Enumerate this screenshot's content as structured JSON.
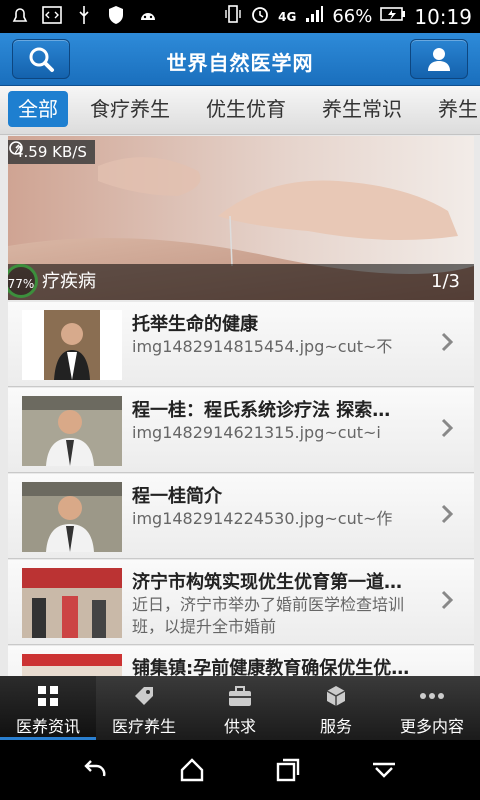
{
  "status_bar": {
    "battery": "66%",
    "time": "10:19",
    "network": "4G"
  },
  "header": {
    "title": "世界自然医学网",
    "search_icon": "search-icon",
    "user_icon": "user-icon"
  },
  "tabs": [
    "全部",
    "食疗养生",
    "优生优育",
    "养生常识",
    "养生"
  ],
  "banner": {
    "speed": "4.59 KB/S",
    "progress": "77%",
    "caption": "疗疾病",
    "pager": "1/3"
  },
  "articles": [
    {
      "title": "托举生命的健康",
      "summary": "img1482914815454.jpg~cut~不"
    },
    {
      "title": "程一桂：程氏系统诊疗法  探索…",
      "summary": "img1482914621315.jpg~cut~i"
    },
    {
      "title": "程一桂简介",
      "summary": "img1482914224530.jpg~cut~作"
    },
    {
      "title": "济宁市构筑实现优生优育第一道…",
      "summary": "近日，济宁市举办了婚前医学检查培训班，以提升全市婚前"
    },
    {
      "title": "铺集镇:孕前健康教育确保优生优…",
      "summary": ""
    }
  ],
  "bottom_nav": [
    "医养资讯",
    "医疗养生",
    "供求",
    "服务",
    "更多内容"
  ],
  "colors": {
    "accent": "#1e7fd0",
    "header": "#1a6fbd"
  }
}
